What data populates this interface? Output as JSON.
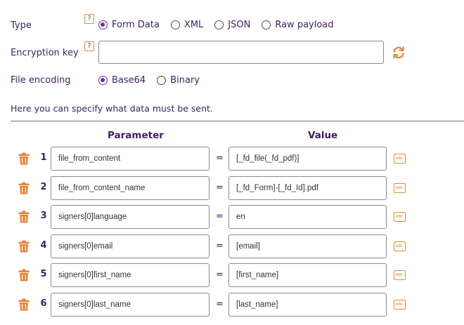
{
  "type_row": {
    "label": "Type",
    "help": "?",
    "options": [
      {
        "label": "Form Data",
        "checked": true
      },
      {
        "label": "XML",
        "checked": false
      },
      {
        "label": "JSON",
        "checked": false
      },
      {
        "label": "Raw payload",
        "checked": false
      }
    ]
  },
  "encryption_row": {
    "label": "Encryption key",
    "help": "?",
    "value": "",
    "refresh_icon": "refresh-icon"
  },
  "file_encoding_row": {
    "label": "File encoding",
    "options": [
      {
        "label": "Base64",
        "checked": true
      },
      {
        "label": "Binary",
        "checked": false
      }
    ]
  },
  "hint": "Here you can specify what data must be sent.",
  "table": {
    "headers": {
      "parameter": "Parameter",
      "value": "Value"
    },
    "equals": "=",
    "abc_badge": "ABC",
    "rows": [
      {
        "num": "1",
        "parameter": "file_from_content",
        "value": "[_fd_file(_fd_pdf)]"
      },
      {
        "num": "2",
        "parameter": "file_from_content_name",
        "value": "[_fd_Form]-[_fd_Id].pdf"
      },
      {
        "num": "3",
        "parameter": "signers[0]language",
        "value": "en"
      },
      {
        "num": "4",
        "parameter": "signers[0]email",
        "value": "[email]"
      },
      {
        "num": "5",
        "parameter": "signers[0]first_name",
        "value": "[first_name]"
      },
      {
        "num": "6",
        "parameter": "signers[0]last_name",
        "value": "[last_name]"
      }
    ]
  },
  "colors": {
    "accent": "#6a2f9a",
    "orange": "#e8823a",
    "text": "#3d1f63"
  }
}
